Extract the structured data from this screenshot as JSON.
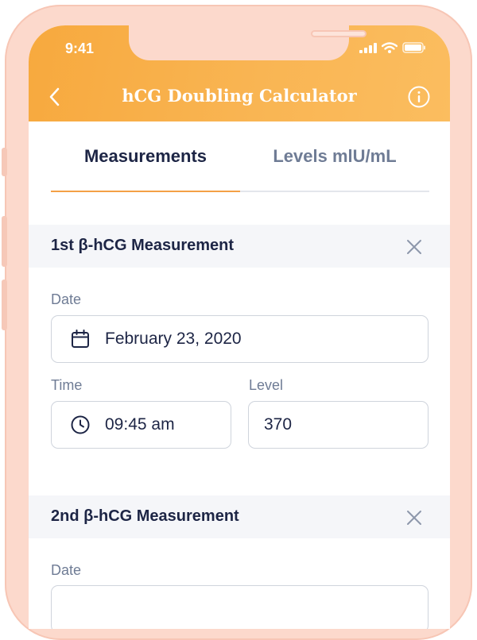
{
  "status_bar": {
    "time": "9:41"
  },
  "header": {
    "title": "hCG Doubling Calculator"
  },
  "tabs": [
    {
      "label": "Measurements",
      "active": true
    },
    {
      "label": "Levels mlU/mL",
      "active": false
    }
  ],
  "measurements": [
    {
      "title": "1st β-hCG Measurement",
      "date_label": "Date",
      "date_value": "February 23, 2020",
      "time_label": "Time",
      "time_value": "09:45 am",
      "level_label": "Level",
      "level_value": "370"
    },
    {
      "title": "2nd β-hCG Measurement",
      "date_label": "Date"
    }
  ],
  "icons": {
    "back": "chevron-left-icon",
    "info": "info-icon",
    "close": "close-icon",
    "calendar": "calendar-icon",
    "clock": "clock-icon",
    "signal": "signal-icon",
    "wifi": "wifi-icon",
    "battery": "battery-icon"
  },
  "colors": {
    "accent": "#f7a93e",
    "frame": "#fcd9cc",
    "text_dark": "#1d2545",
    "text_muted": "#6f7c95"
  }
}
